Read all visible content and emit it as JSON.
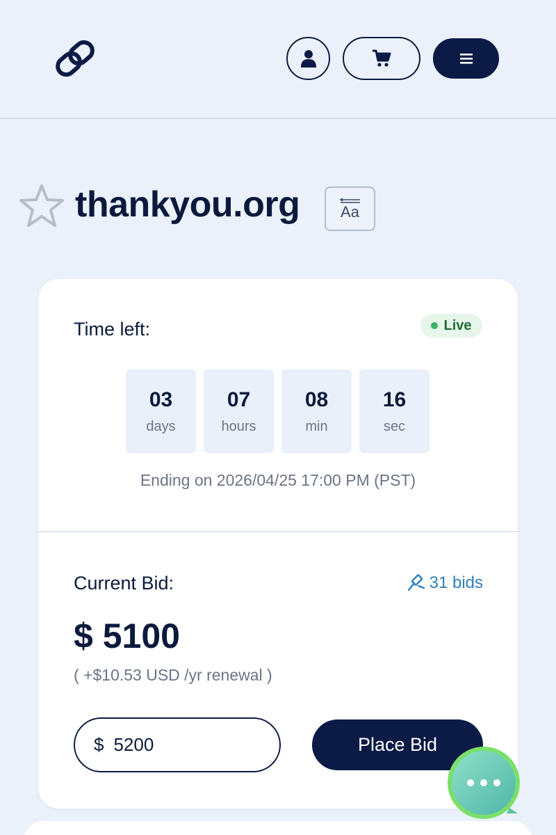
{
  "header": {
    "logo_icon": "link-logo-icon",
    "account_icon": "user-icon",
    "cart_icon": "cart-icon",
    "menu_icon": "hamburger-icon"
  },
  "domain": {
    "name": "thankyou.org",
    "favorite_icon": "star-outline-icon",
    "translate_icon": "translate-aa-icon",
    "translate_glyph": "Aa"
  },
  "auction": {
    "time_left_label": "Time left:",
    "status": "Live",
    "countdown": [
      {
        "value": "03",
        "unit": "days"
      },
      {
        "value": "07",
        "unit": "hours"
      },
      {
        "value": "08",
        "unit": "min"
      },
      {
        "value": "16",
        "unit": "sec"
      }
    ],
    "ending": "Ending on 2026/04/25 17:00 PM (PST)"
  },
  "bidding": {
    "current_bid_label": "Current Bid:",
    "bids_count": "31 bids",
    "current_bid": "$ 5100",
    "renewal": "( +$10.53 USD /yr renewal )",
    "currency_symbol": "$",
    "bid_input_value": "5200",
    "place_bid_label": "Place Bid"
  },
  "colors": {
    "background": "#ebf1fb",
    "navy": "#0c1a46",
    "live_green": "#3fb365",
    "link_blue": "#2f7fbd"
  },
  "chat": {
    "icon": "chat-bubble-icon"
  }
}
